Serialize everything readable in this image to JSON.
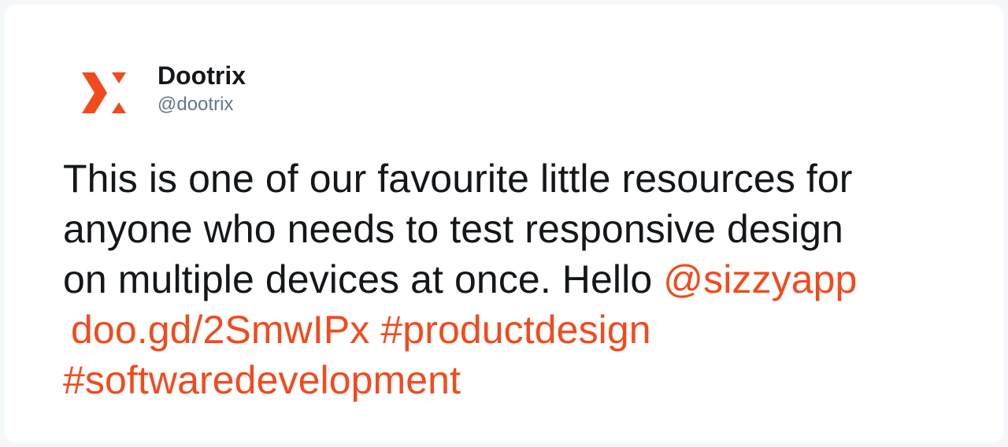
{
  "tweet": {
    "author": {
      "name": "Dootrix",
      "handle": "@dootrix",
      "avatar_icon": "dootrix-logo-icon",
      "brand_color": "#f24a1d"
    },
    "text": {
      "line1": "This is one of our favourite little resources for",
      "line2": "anyone who needs to test responsive design",
      "line3_text": "on multiple devices at once. Hello ",
      "mention": "@sizzyapp",
      "link": "doo.gd/2SmwIPx",
      "hashtag1": "#productdesign",
      "hashtag2": "#softwaredevelopment"
    },
    "colors": {
      "text": "#14171a",
      "secondary": "#657786",
      "link": "#f24a1d"
    }
  }
}
